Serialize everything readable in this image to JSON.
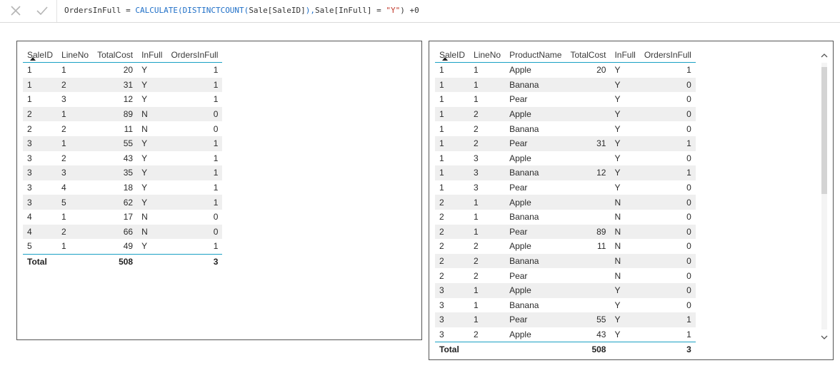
{
  "formula": {
    "measure": "OrdersInFull",
    "op1": " = ",
    "fn1": "CALCULATE(DISTINCTCOUNT(",
    "arg1": "Sale[SaleID]",
    "mid": "),",
    "arg2": "Sale[InFull]",
    "op2": " = ",
    "str": "\"Y\"",
    "tail": ") +0",
    "cancel_icon": "x-icon",
    "commit_icon": "check-icon"
  },
  "left_table": {
    "headers": [
      "SaleID",
      "LineNo",
      "TotalCost",
      "InFull",
      "OrdersInFull"
    ],
    "rows": [
      [
        "1",
        "1",
        "20",
        "Y",
        "1"
      ],
      [
        "1",
        "2",
        "31",
        "Y",
        "1"
      ],
      [
        "1",
        "3",
        "12",
        "Y",
        "1"
      ],
      [
        "2",
        "1",
        "89",
        "N",
        "0"
      ],
      [
        "2",
        "2",
        "11",
        "N",
        "0"
      ],
      [
        "3",
        "1",
        "55",
        "Y",
        "1"
      ],
      [
        "3",
        "2",
        "43",
        "Y",
        "1"
      ],
      [
        "3",
        "3",
        "35",
        "Y",
        "1"
      ],
      [
        "3",
        "4",
        "18",
        "Y",
        "1"
      ],
      [
        "3",
        "5",
        "62",
        "Y",
        "1"
      ],
      [
        "4",
        "1",
        "17",
        "N",
        "0"
      ],
      [
        "4",
        "2",
        "66",
        "N",
        "0"
      ],
      [
        "5",
        "1",
        "49",
        "Y",
        "1"
      ]
    ],
    "total": [
      "Total",
      "",
      "508",
      "",
      "3"
    ]
  },
  "right_table": {
    "headers": [
      "SaleID",
      "LineNo",
      "ProductName",
      "TotalCost",
      "InFull",
      "OrdersInFull"
    ],
    "rows": [
      [
        "1",
        "1",
        "Apple",
        "20",
        "Y",
        "1"
      ],
      [
        "1",
        "1",
        "Banana",
        "",
        "Y",
        "0"
      ],
      [
        "1",
        "1",
        "Pear",
        "",
        "Y",
        "0"
      ],
      [
        "1",
        "2",
        "Apple",
        "",
        "Y",
        "0"
      ],
      [
        "1",
        "2",
        "Banana",
        "",
        "Y",
        "0"
      ],
      [
        "1",
        "2",
        "Pear",
        "31",
        "Y",
        "1"
      ],
      [
        "1",
        "3",
        "Apple",
        "",
        "Y",
        "0"
      ],
      [
        "1",
        "3",
        "Banana",
        "12",
        "Y",
        "1"
      ],
      [
        "1",
        "3",
        "Pear",
        "",
        "Y",
        "0"
      ],
      [
        "2",
        "1",
        "Apple",
        "",
        "N",
        "0"
      ],
      [
        "2",
        "1",
        "Banana",
        "",
        "N",
        "0"
      ],
      [
        "2",
        "1",
        "Pear",
        "89",
        "N",
        "0"
      ],
      [
        "2",
        "2",
        "Apple",
        "11",
        "N",
        "0"
      ],
      [
        "2",
        "2",
        "Banana",
        "",
        "N",
        "0"
      ],
      [
        "2",
        "2",
        "Pear",
        "",
        "N",
        "0"
      ],
      [
        "3",
        "1",
        "Apple",
        "",
        "Y",
        "0"
      ],
      [
        "3",
        "1",
        "Banana",
        "",
        "Y",
        "0"
      ],
      [
        "3",
        "1",
        "Pear",
        "55",
        "Y",
        "1"
      ],
      [
        "3",
        "2",
        "Apple",
        "43",
        "Y",
        "1"
      ]
    ],
    "total": [
      "Total",
      "",
      "",
      "508",
      "",
      "3"
    ]
  },
  "scrollbar": {
    "up_icon": "chevron-up-icon",
    "down_icon": "chevron-down-icon"
  }
}
